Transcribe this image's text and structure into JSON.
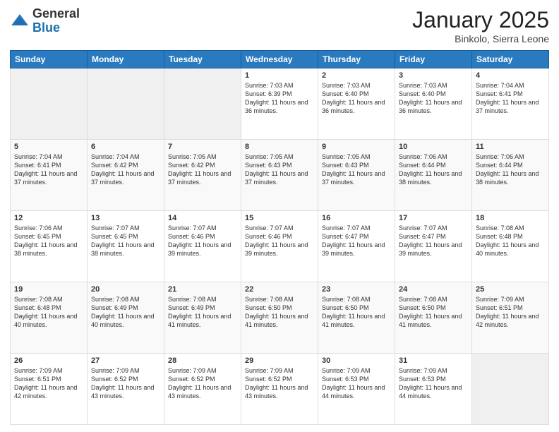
{
  "logo": {
    "general": "General",
    "blue": "Blue"
  },
  "title": "January 2025",
  "location": "Binkolo, Sierra Leone",
  "weekdays": [
    "Sunday",
    "Monday",
    "Tuesday",
    "Wednesday",
    "Thursday",
    "Friday",
    "Saturday"
  ],
  "weeks": [
    [
      {
        "day": "",
        "info": ""
      },
      {
        "day": "",
        "info": ""
      },
      {
        "day": "",
        "info": ""
      },
      {
        "day": "1",
        "info": "Sunrise: 7:03 AM\nSunset: 6:39 PM\nDaylight: 11 hours and 36 minutes."
      },
      {
        "day": "2",
        "info": "Sunrise: 7:03 AM\nSunset: 6:40 PM\nDaylight: 11 hours and 36 minutes."
      },
      {
        "day": "3",
        "info": "Sunrise: 7:03 AM\nSunset: 6:40 PM\nDaylight: 11 hours and 36 minutes."
      },
      {
        "day": "4",
        "info": "Sunrise: 7:04 AM\nSunset: 6:41 PM\nDaylight: 11 hours and 37 minutes."
      }
    ],
    [
      {
        "day": "5",
        "info": "Sunrise: 7:04 AM\nSunset: 6:41 PM\nDaylight: 11 hours and 37 minutes."
      },
      {
        "day": "6",
        "info": "Sunrise: 7:04 AM\nSunset: 6:42 PM\nDaylight: 11 hours and 37 minutes."
      },
      {
        "day": "7",
        "info": "Sunrise: 7:05 AM\nSunset: 6:42 PM\nDaylight: 11 hours and 37 minutes."
      },
      {
        "day": "8",
        "info": "Sunrise: 7:05 AM\nSunset: 6:43 PM\nDaylight: 11 hours and 37 minutes."
      },
      {
        "day": "9",
        "info": "Sunrise: 7:05 AM\nSunset: 6:43 PM\nDaylight: 11 hours and 37 minutes."
      },
      {
        "day": "10",
        "info": "Sunrise: 7:06 AM\nSunset: 6:44 PM\nDaylight: 11 hours and 38 minutes."
      },
      {
        "day": "11",
        "info": "Sunrise: 7:06 AM\nSunset: 6:44 PM\nDaylight: 11 hours and 38 minutes."
      }
    ],
    [
      {
        "day": "12",
        "info": "Sunrise: 7:06 AM\nSunset: 6:45 PM\nDaylight: 11 hours and 38 minutes."
      },
      {
        "day": "13",
        "info": "Sunrise: 7:07 AM\nSunset: 6:45 PM\nDaylight: 11 hours and 38 minutes."
      },
      {
        "day": "14",
        "info": "Sunrise: 7:07 AM\nSunset: 6:46 PM\nDaylight: 11 hours and 39 minutes."
      },
      {
        "day": "15",
        "info": "Sunrise: 7:07 AM\nSunset: 6:46 PM\nDaylight: 11 hours and 39 minutes."
      },
      {
        "day": "16",
        "info": "Sunrise: 7:07 AM\nSunset: 6:47 PM\nDaylight: 11 hours and 39 minutes."
      },
      {
        "day": "17",
        "info": "Sunrise: 7:07 AM\nSunset: 6:47 PM\nDaylight: 11 hours and 39 minutes."
      },
      {
        "day": "18",
        "info": "Sunrise: 7:08 AM\nSunset: 6:48 PM\nDaylight: 11 hours and 40 minutes."
      }
    ],
    [
      {
        "day": "19",
        "info": "Sunrise: 7:08 AM\nSunset: 6:48 PM\nDaylight: 11 hours and 40 minutes."
      },
      {
        "day": "20",
        "info": "Sunrise: 7:08 AM\nSunset: 6:49 PM\nDaylight: 11 hours and 40 minutes."
      },
      {
        "day": "21",
        "info": "Sunrise: 7:08 AM\nSunset: 6:49 PM\nDaylight: 11 hours and 41 minutes."
      },
      {
        "day": "22",
        "info": "Sunrise: 7:08 AM\nSunset: 6:50 PM\nDaylight: 11 hours and 41 minutes."
      },
      {
        "day": "23",
        "info": "Sunrise: 7:08 AM\nSunset: 6:50 PM\nDaylight: 11 hours and 41 minutes."
      },
      {
        "day": "24",
        "info": "Sunrise: 7:08 AM\nSunset: 6:50 PM\nDaylight: 11 hours and 41 minutes."
      },
      {
        "day": "25",
        "info": "Sunrise: 7:09 AM\nSunset: 6:51 PM\nDaylight: 11 hours and 42 minutes."
      }
    ],
    [
      {
        "day": "26",
        "info": "Sunrise: 7:09 AM\nSunset: 6:51 PM\nDaylight: 11 hours and 42 minutes."
      },
      {
        "day": "27",
        "info": "Sunrise: 7:09 AM\nSunset: 6:52 PM\nDaylight: 11 hours and 43 minutes."
      },
      {
        "day": "28",
        "info": "Sunrise: 7:09 AM\nSunset: 6:52 PM\nDaylight: 11 hours and 43 minutes."
      },
      {
        "day": "29",
        "info": "Sunrise: 7:09 AM\nSunset: 6:52 PM\nDaylight: 11 hours and 43 minutes."
      },
      {
        "day": "30",
        "info": "Sunrise: 7:09 AM\nSunset: 6:53 PM\nDaylight: 11 hours and 44 minutes."
      },
      {
        "day": "31",
        "info": "Sunrise: 7:09 AM\nSunset: 6:53 PM\nDaylight: 11 hours and 44 minutes."
      },
      {
        "day": "",
        "info": ""
      }
    ]
  ]
}
